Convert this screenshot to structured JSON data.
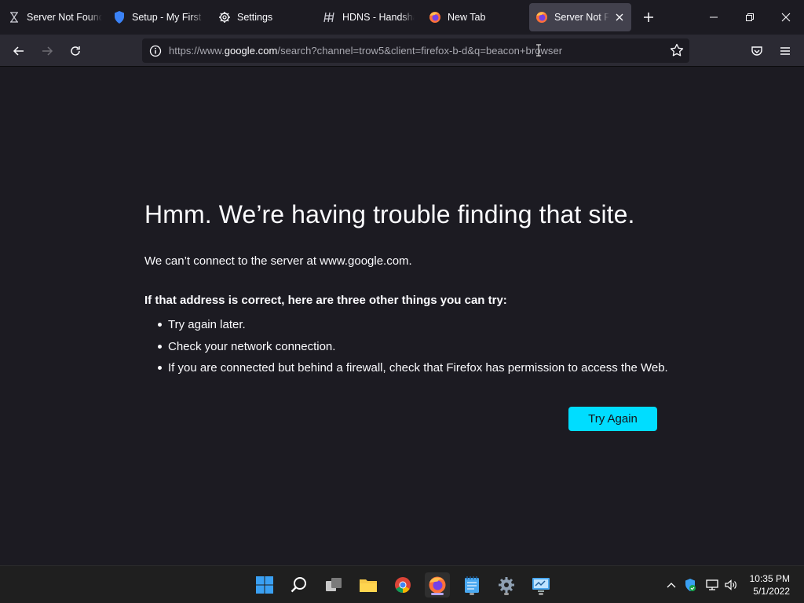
{
  "tabs": [
    {
      "label": "Server Not Found",
      "icon": "hourglass-icon"
    },
    {
      "label": "Setup - My First C",
      "icon": "shield-icon"
    },
    {
      "label": "Settings",
      "icon": "gear-icon"
    },
    {
      "label": "HDNS - Handsha",
      "icon": "handshake-icon"
    },
    {
      "label": "New Tab",
      "icon": "firefox-icon"
    },
    {
      "label": "Server Not Fou",
      "icon": "firefox-icon",
      "active": true
    }
  ],
  "url": {
    "prefix": "https://www.",
    "host": "google.com",
    "rest": "/search?channel=trow5&client=firefox-b-d&q=beacon+browser"
  },
  "error": {
    "title": "Hmm. We’re having trouble finding that site.",
    "description": "We can’t connect to the server at www.google.com.",
    "lead": "If that address is correct, here are three other things you can try:",
    "tips": [
      "Try again later.",
      "Check your network connection.",
      "If you are connected but behind a firewall, check that Firefox has permission to access the Web."
    ],
    "button": "Try Again"
  },
  "taskbar": {
    "apps": [
      "windows-start-icon",
      "search-icon",
      "task-view-icon",
      "file-explorer-icon",
      "chrome-icon",
      "firefox-icon",
      "notepad-icon",
      "settings-icon",
      "control-panel-icon"
    ]
  },
  "clock": {
    "time": "10:35 PM",
    "date": "5/1/2022"
  },
  "colors": {
    "accent": "#00ddff",
    "background": "#1c1b22",
    "toolbar": "#2b2a33"
  }
}
